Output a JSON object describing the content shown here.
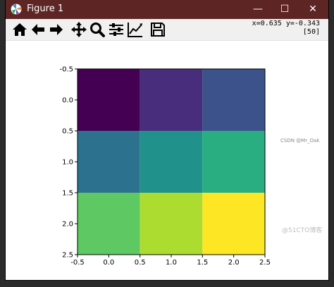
{
  "window": {
    "title": "Figure 1",
    "controls": {
      "minimize": "—",
      "maximize": "☐",
      "close": "✕"
    }
  },
  "toolbar": {
    "tools": [
      {
        "name": "home-icon"
      },
      {
        "name": "back-arrow-icon"
      },
      {
        "name": "forward-arrow-icon"
      },
      {
        "name": "pan-icon"
      },
      {
        "name": "zoom-icon"
      },
      {
        "name": "configure-subplots-icon"
      },
      {
        "name": "edit-axis-icon"
      },
      {
        "name": "save-icon"
      }
    ],
    "coord_readout": "x=0.635 y=-0.343",
    "value_readout": "[50]"
  },
  "watermarks": {
    "small": "CSDN @Mr_Oak",
    "bottom": "@51CTO博客"
  },
  "chart_data": {
    "type": "heatmap",
    "colormap": "viridis",
    "values": [
      [
        10,
        20,
        30
      ],
      [
        40,
        50,
        60
      ],
      [
        70,
        80,
        90
      ]
    ],
    "colors": [
      [
        "#440154",
        "#472d7b",
        "#3b528b"
      ],
      [
        "#2c728e",
        "#21918c",
        "#28ae80"
      ],
      [
        "#5ec962",
        "#addc30",
        "#fde725"
      ]
    ],
    "xlim": [
      -0.5,
      2.5
    ],
    "ylim": [
      2.5,
      -0.5
    ],
    "x_ticks": [
      "-0.5",
      "0.0",
      "0.5",
      "1.0",
      "1.5",
      "2.0",
      "2.5"
    ],
    "y_ticks": [
      "-0.5",
      "0.0",
      "0.5",
      "1.0",
      "1.5",
      "2.0",
      "2.5"
    ],
    "title": "",
    "xlabel": "",
    "ylabel": ""
  }
}
